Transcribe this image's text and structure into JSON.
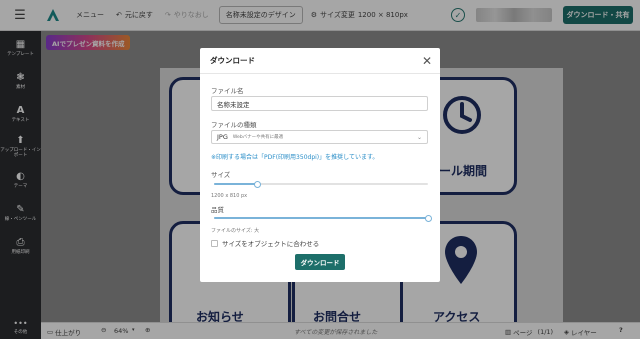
{
  "header": {
    "menu_label": "メニュー",
    "undo_label": "元に戻す",
    "redo_label": "やりなおし",
    "design_name": "名称未設定のデザイン",
    "size_change_label": "サイズ変更",
    "size_value": "1200 × 810px",
    "download_share_label": "ダウンロード・共有"
  },
  "sidebar": {
    "items": [
      {
        "icon": "layout-icon",
        "label": "テンプレート"
      },
      {
        "icon": "elements-icon",
        "label": "素材"
      },
      {
        "icon": "text-icon",
        "label": "テキスト"
      },
      {
        "icon": "upload-icon",
        "label": "アップロード・インポート"
      },
      {
        "icon": "theme-icon",
        "label": "テーマ"
      },
      {
        "icon": "draw-icon",
        "label": "線・ペンツール"
      },
      {
        "icon": "print-icon",
        "label": "用紙印刷"
      }
    ],
    "more_label": "その他"
  },
  "canvas": {
    "ai_button_label": "AIでプレゼン資料を作成",
    "tile_texts": [
      "ール期間",
      "お知らせ",
      "お問合せ",
      "アクセス"
    ]
  },
  "bottombar": {
    "finish_label": "仕上がり",
    "zoom_value": "64%",
    "autosave_status": "すべての変更が保存されました",
    "page_label": "ページ",
    "page_count": "(1/1)",
    "layer_label": "レイヤー",
    "help_label": "?"
  },
  "modal": {
    "title": "ダウンロード",
    "filename_label": "ファイル名",
    "filename_value": "名称未設定",
    "filetype_label": "ファイルの種類",
    "filetype_value": "JPG",
    "filetype_sub": "Webバナーや共有に最適",
    "print_note": "※印刷する場合は「PDF(印刷用350dpi)」を推奨しています。",
    "size_label": "サイズ",
    "size_slider_fraction": 0.2,
    "size_readout": "1200 x 810 px",
    "quality_label": "品質",
    "quality_slider_fraction": 1.0,
    "filesize_label": "ファイルのサイズ: 大",
    "fit_object_label": "サイズをオブジェクトに合わせる",
    "download_button_label": "ダウンロード"
  },
  "colors": {
    "brand_teal": "#1d6f6a",
    "sidebar_bg": "#2b2d31",
    "tile_navy": "#1f2f63",
    "link_blue": "#2a8ec8"
  }
}
